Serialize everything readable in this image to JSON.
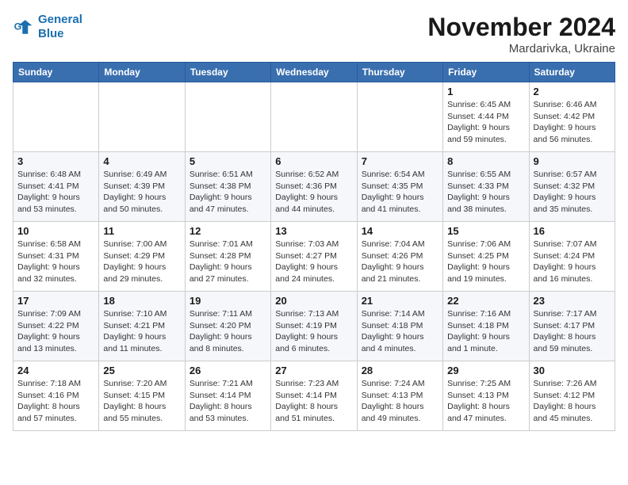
{
  "logo": {
    "line1": "General",
    "line2": "Blue"
  },
  "title": "November 2024",
  "location": "Mardarivka, Ukraine",
  "days_header": [
    "Sunday",
    "Monday",
    "Tuesday",
    "Wednesday",
    "Thursday",
    "Friday",
    "Saturday"
  ],
  "weeks": [
    [
      {
        "day": "",
        "info": ""
      },
      {
        "day": "",
        "info": ""
      },
      {
        "day": "",
        "info": ""
      },
      {
        "day": "",
        "info": ""
      },
      {
        "day": "",
        "info": ""
      },
      {
        "day": "1",
        "info": "Sunrise: 6:45 AM\nSunset: 4:44 PM\nDaylight: 9 hours and 59 minutes."
      },
      {
        "day": "2",
        "info": "Sunrise: 6:46 AM\nSunset: 4:42 PM\nDaylight: 9 hours and 56 minutes."
      }
    ],
    [
      {
        "day": "3",
        "info": "Sunrise: 6:48 AM\nSunset: 4:41 PM\nDaylight: 9 hours and 53 minutes."
      },
      {
        "day": "4",
        "info": "Sunrise: 6:49 AM\nSunset: 4:39 PM\nDaylight: 9 hours and 50 minutes."
      },
      {
        "day": "5",
        "info": "Sunrise: 6:51 AM\nSunset: 4:38 PM\nDaylight: 9 hours and 47 minutes."
      },
      {
        "day": "6",
        "info": "Sunrise: 6:52 AM\nSunset: 4:36 PM\nDaylight: 9 hours and 44 minutes."
      },
      {
        "day": "7",
        "info": "Sunrise: 6:54 AM\nSunset: 4:35 PM\nDaylight: 9 hours and 41 minutes."
      },
      {
        "day": "8",
        "info": "Sunrise: 6:55 AM\nSunset: 4:33 PM\nDaylight: 9 hours and 38 minutes."
      },
      {
        "day": "9",
        "info": "Sunrise: 6:57 AM\nSunset: 4:32 PM\nDaylight: 9 hours and 35 minutes."
      }
    ],
    [
      {
        "day": "10",
        "info": "Sunrise: 6:58 AM\nSunset: 4:31 PM\nDaylight: 9 hours and 32 minutes."
      },
      {
        "day": "11",
        "info": "Sunrise: 7:00 AM\nSunset: 4:29 PM\nDaylight: 9 hours and 29 minutes."
      },
      {
        "day": "12",
        "info": "Sunrise: 7:01 AM\nSunset: 4:28 PM\nDaylight: 9 hours and 27 minutes."
      },
      {
        "day": "13",
        "info": "Sunrise: 7:03 AM\nSunset: 4:27 PM\nDaylight: 9 hours and 24 minutes."
      },
      {
        "day": "14",
        "info": "Sunrise: 7:04 AM\nSunset: 4:26 PM\nDaylight: 9 hours and 21 minutes."
      },
      {
        "day": "15",
        "info": "Sunrise: 7:06 AM\nSunset: 4:25 PM\nDaylight: 9 hours and 19 minutes."
      },
      {
        "day": "16",
        "info": "Sunrise: 7:07 AM\nSunset: 4:24 PM\nDaylight: 9 hours and 16 minutes."
      }
    ],
    [
      {
        "day": "17",
        "info": "Sunrise: 7:09 AM\nSunset: 4:22 PM\nDaylight: 9 hours and 13 minutes."
      },
      {
        "day": "18",
        "info": "Sunrise: 7:10 AM\nSunset: 4:21 PM\nDaylight: 9 hours and 11 minutes."
      },
      {
        "day": "19",
        "info": "Sunrise: 7:11 AM\nSunset: 4:20 PM\nDaylight: 9 hours and 8 minutes."
      },
      {
        "day": "20",
        "info": "Sunrise: 7:13 AM\nSunset: 4:19 PM\nDaylight: 9 hours and 6 minutes."
      },
      {
        "day": "21",
        "info": "Sunrise: 7:14 AM\nSunset: 4:18 PM\nDaylight: 9 hours and 4 minutes."
      },
      {
        "day": "22",
        "info": "Sunrise: 7:16 AM\nSunset: 4:18 PM\nDaylight: 9 hours and 1 minute."
      },
      {
        "day": "23",
        "info": "Sunrise: 7:17 AM\nSunset: 4:17 PM\nDaylight: 8 hours and 59 minutes."
      }
    ],
    [
      {
        "day": "24",
        "info": "Sunrise: 7:18 AM\nSunset: 4:16 PM\nDaylight: 8 hours and 57 minutes."
      },
      {
        "day": "25",
        "info": "Sunrise: 7:20 AM\nSunset: 4:15 PM\nDaylight: 8 hours and 55 minutes."
      },
      {
        "day": "26",
        "info": "Sunrise: 7:21 AM\nSunset: 4:14 PM\nDaylight: 8 hours and 53 minutes."
      },
      {
        "day": "27",
        "info": "Sunrise: 7:23 AM\nSunset: 4:14 PM\nDaylight: 8 hours and 51 minutes."
      },
      {
        "day": "28",
        "info": "Sunrise: 7:24 AM\nSunset: 4:13 PM\nDaylight: 8 hours and 49 minutes."
      },
      {
        "day": "29",
        "info": "Sunrise: 7:25 AM\nSunset: 4:13 PM\nDaylight: 8 hours and 47 minutes."
      },
      {
        "day": "30",
        "info": "Sunrise: 7:26 AM\nSunset: 4:12 PM\nDaylight: 8 hours and 45 minutes."
      }
    ]
  ]
}
